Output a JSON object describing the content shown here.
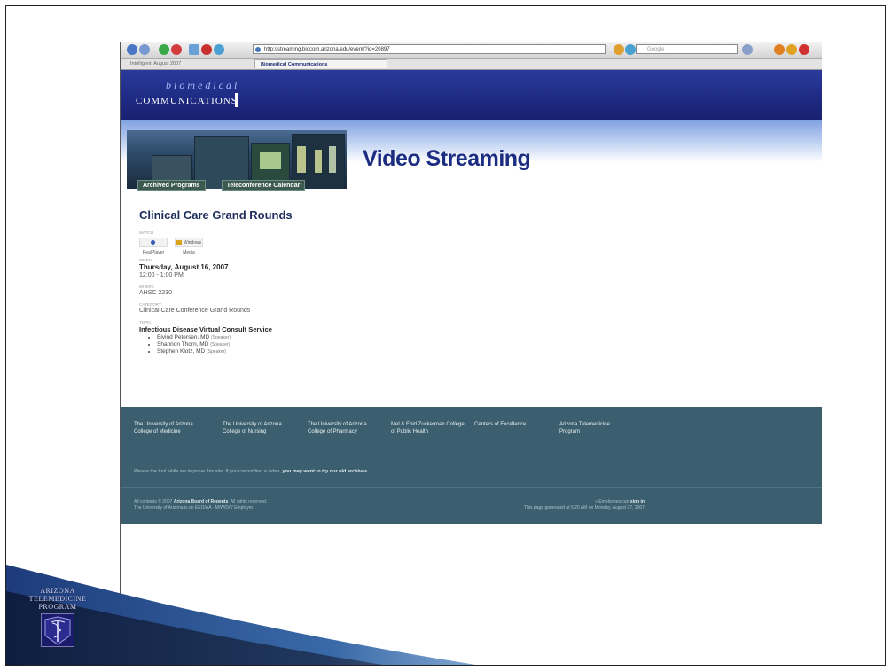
{
  "browser": {
    "url": "http://streaming.biocom.arizona.edu/event/?id=20897",
    "search_placeholder": "Google",
    "tabs": [
      {
        "label": "Intelligent, August 2007"
      },
      {
        "label": "Biomedical Communications"
      }
    ]
  },
  "header": {
    "logo_top": "biomedical",
    "logo_bottom": "COMMUNICATIONS"
  },
  "banner": {
    "title": "Video Streaming",
    "tabs": [
      "Archived Programs",
      "Teleconference Calendar"
    ]
  },
  "event": {
    "title": "Clinical Care Grand Rounds",
    "labels": {
      "watch": "WATCH",
      "when": "WHEN",
      "where": "WHERE",
      "category": "CATEGORY",
      "topic": "TOPIC"
    },
    "watch_options": [
      "RealPlayer",
      "Windows Media"
    ],
    "date": "Thursday, August 16, 2007",
    "time": "12:00 - 1:00 PM",
    "location": "AHSC 2230",
    "category": "Clinical Care Conference Grand Rounds",
    "topic": "Infectious Disease Virtual Consult Service",
    "speakers": [
      {
        "name": "Eivind Petersen, MD",
        "role": "(Speaker)"
      },
      {
        "name": "Shannon Thorn, MD",
        "role": "(Speaker)"
      },
      {
        "name": "Stephen Klotz, MD",
        "role": "(Speaker)"
      }
    ]
  },
  "footer": {
    "links": [
      "The University of Arizona College of Medicine",
      "The University of Arizona College of Nursing",
      "The University of Arizona College of Pharmacy",
      "Mel & Enid Zuckerman College of Public Health",
      "Centers of Excellence",
      "Arizona Telemedicine Program"
    ],
    "note": "Please the tool while we improve this site. If you cannot find a video,",
    "note_link": "you may want to try our old archives",
    "copyright_line1": "All contents © 2007",
    "copyright_org": "Arizona Board of Regents",
    "copyright_rest": ". All rights reserved.",
    "copyright_line2": "The University of Arizona is an EEO/AA - M/W/D/V Employer.",
    "right_line1_pre": "» Employees can",
    "right_line1_link": "sign in",
    "right_line2": "This page generated at 5:20 AM on Monday, August 27, 2007"
  },
  "program": {
    "name_lines": [
      "ARIZONA",
      "TELEMEDICINE",
      "PROGRAM"
    ]
  },
  "colors": {
    "header_blue": "#1e2a82",
    "footer_teal": "#3b5f6e",
    "title_navy": "#1c2c80"
  }
}
